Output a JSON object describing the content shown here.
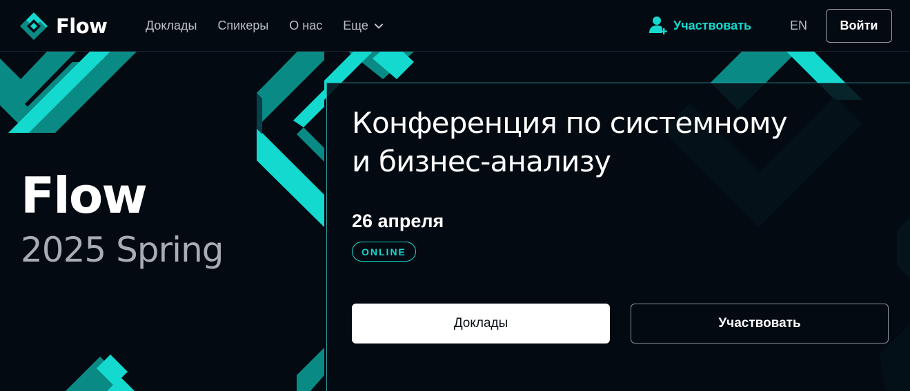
{
  "header": {
    "logo_text": "Flow",
    "nav": [
      {
        "label": "Доклады"
      },
      {
        "label": "Спикеры"
      },
      {
        "label": "О нас"
      },
      {
        "label": "Еще"
      }
    ],
    "participate_label": "Участвовать",
    "lang_label": "EN",
    "login_label": "Войти"
  },
  "hero": {
    "brand_title": "Flow",
    "brand_subtitle": "2025 Spring",
    "title_line1": "Конференция по системному",
    "title_line2": "и бизнес-анализу",
    "date": "26 апреля",
    "format_badge": "ONLINE",
    "primary_button": "Доклады",
    "secondary_button": "Участвовать"
  },
  "colors": {
    "background": "#040a12",
    "accent_cyan": "#14d9cf",
    "accent_teal": "#0a8a84"
  },
  "icons": [
    "flow-logo-icon",
    "chevron-down-icon",
    "user-add-icon"
  ]
}
